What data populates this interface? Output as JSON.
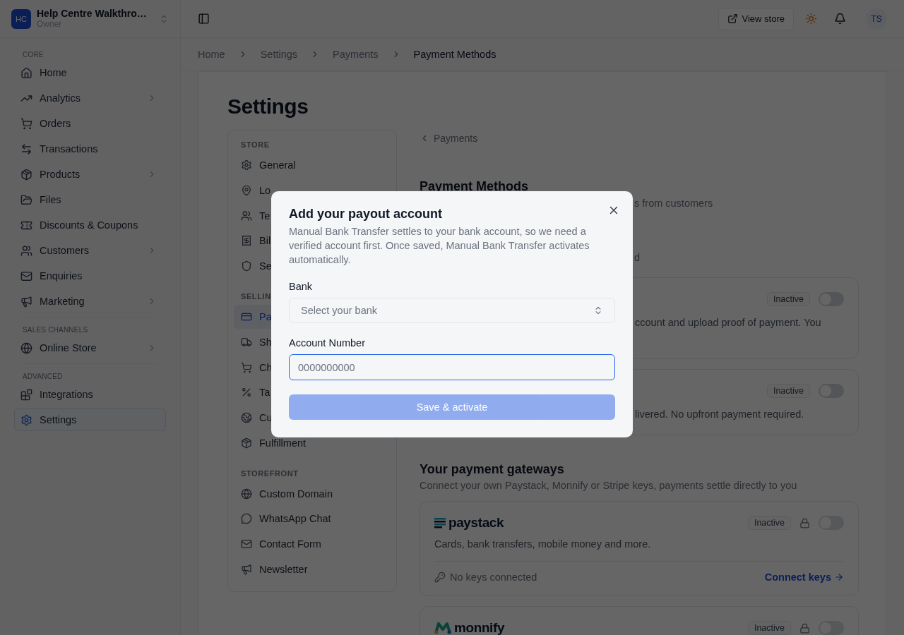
{
  "sidebar": {
    "workspace": {
      "initials": "HC",
      "name": "Help Centre Walkthro…",
      "role": "Owner"
    },
    "sections": [
      {
        "title": "CORE",
        "items": [
          {
            "label": "Home",
            "has_submenu": false,
            "selected": false
          },
          {
            "label": "Analytics",
            "has_submenu": true,
            "selected": false
          },
          {
            "label": "Orders",
            "has_submenu": false,
            "selected": false
          },
          {
            "label": "Transactions",
            "has_submenu": false,
            "selected": false
          },
          {
            "label": "Products",
            "has_submenu": true,
            "selected": false
          },
          {
            "label": "Files",
            "has_submenu": false,
            "selected": false
          },
          {
            "label": "Discounts & Coupons",
            "has_submenu": false,
            "selected": false
          },
          {
            "label": "Customers",
            "has_submenu": true,
            "selected": false
          },
          {
            "label": "Enquiries",
            "has_submenu": false,
            "selected": false
          },
          {
            "label": "Marketing",
            "has_submenu": true,
            "selected": false
          }
        ]
      },
      {
        "title": "SALES CHANNELS",
        "items": [
          {
            "label": "Online Store",
            "has_submenu": true,
            "selected": false
          }
        ]
      },
      {
        "title": "ADVANCED",
        "items": [
          {
            "label": "Integrations",
            "has_submenu": false,
            "selected": false
          },
          {
            "label": "Settings",
            "has_submenu": false,
            "selected": true
          }
        ]
      }
    ]
  },
  "header": {
    "view_store": "View store",
    "avatar": "TS"
  },
  "breadcrumb": [
    "Home",
    "Settings",
    "Payments",
    "Payment Methods"
  ],
  "page_title": "Settings",
  "settings_nav": [
    {
      "title": "STORE",
      "items": [
        {
          "label": "General",
          "selected": false
        },
        {
          "label": "Lo",
          "selected": false
        },
        {
          "label": "Te",
          "selected": false
        },
        {
          "label": "Bil",
          "selected": false
        },
        {
          "label": "Se",
          "selected": false
        }
      ]
    },
    {
      "title": "SELLIN",
      "items": [
        {
          "label": "Pa",
          "selected": true
        },
        {
          "label": "Sh",
          "selected": false
        },
        {
          "label": "Ch",
          "selected": false
        },
        {
          "label": "Ta",
          "selected": false
        },
        {
          "label": "Cu",
          "selected": false
        },
        {
          "label": "Fulfillment",
          "selected": false
        }
      ]
    },
    {
      "title": "STOREFRONT",
      "items": [
        {
          "label": "Custom Domain",
          "selected": false
        },
        {
          "label": "WhatsApp Chat",
          "selected": false
        },
        {
          "label": "Contact Form",
          "selected": false
        },
        {
          "label": "Newsletter",
          "selected": false
        }
      ]
    }
  ],
  "payments": {
    "back_link": "Payments",
    "title": "Payment Methods",
    "subtitle": "s from customers",
    "note": "d",
    "methods": [
      {
        "status": "Inactive",
        "on": false,
        "description": "ccount and upload proof of payment. You"
      },
      {
        "status": "Inactive",
        "on": false,
        "description": "livered. No upfront payment required."
      }
    ]
  },
  "gateways": {
    "title": "Your payment gateways",
    "subtitle": "Connect your own Paystack, Monnify or Stripe keys, payments settle directly to you",
    "items": [
      {
        "kind": "paystack",
        "name": "paystack",
        "status": "Inactive",
        "locked": true,
        "on": false,
        "description": "Cards, bank transfers, mobile money and more.",
        "keys_status": "No keys connected",
        "action": "Connect keys"
      },
      {
        "kind": "monnify",
        "name": "monnify",
        "status": "Inactive",
        "locked": true,
        "on": false
      }
    ]
  },
  "dialog": {
    "title": "Add your payout account",
    "description": "Manual Bank Transfer settles to your bank account, so we need a verified account first. Once saved, Manual Bank Transfer activates automatically.",
    "fields": [
      {
        "kind": "select",
        "label": "Bank",
        "placeholder": "Select your bank",
        "focused": false
      },
      {
        "kind": "input",
        "label": "Account Number",
        "placeholder": "0000000000",
        "focused": true
      }
    ],
    "submit": {
      "label": "Save & activate",
      "disabled": true
    }
  }
}
